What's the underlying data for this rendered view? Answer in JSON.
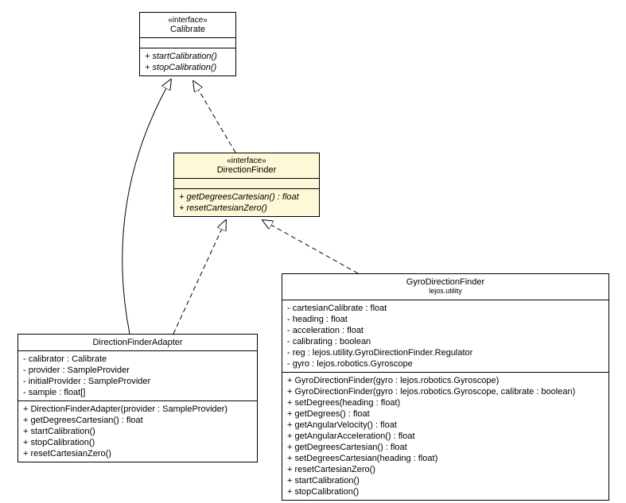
{
  "calibrate": {
    "stereo": "«interface»",
    "name": "Calibrate",
    "ops": [
      "+ startCalibration()",
      "+ stopCalibration()"
    ]
  },
  "dirfinder": {
    "stereo": "«interface»",
    "name": "DirectionFinder",
    "ops": [
      "+ getDegreesCartesian() : float",
      "+ resetCartesianZero()"
    ]
  },
  "adapter": {
    "name": "DirectionFinderAdapter",
    "attrs": [
      "- calibrator : Calibrate",
      "- provider : SampleProvider",
      "- initialProvider : SampleProvider",
      "- sample : float[]"
    ],
    "ops": [
      "+ DirectionFinderAdapter(provider : SampleProvider)",
      "+ getDegreesCartesian() : float",
      "+ startCalibration()",
      "+ stopCalibration()",
      "+ resetCartesianZero()"
    ]
  },
  "gyro": {
    "name": "GyroDirectionFinder",
    "pkg": "lejos.utility",
    "attrs": [
      "- cartesianCalibrate : float",
      "- heading : float",
      "- acceleration : float",
      "- calibrating : boolean",
      "- reg : lejos.utility.GyroDirectionFinder.Regulator",
      "- gyro : lejos.robotics.Gyroscope"
    ],
    "ops": [
      "+ GyroDirectionFinder(gyro : lejos.robotics.Gyroscope)",
      "+ GyroDirectionFinder(gyro : lejos.robotics.Gyroscope, calibrate : boolean)",
      "+ setDegrees(heading : float)",
      "+ getDegrees() : float",
      "+ getAngularVelocity() : float",
      "+ getAngularAcceleration() : float",
      "+ getDegreesCartesian() : float",
      "+ setDegreesCartesian(heading : float)",
      "+ resetCartesianZero()",
      "+ startCalibration()",
      "+ stopCalibration()"
    ]
  }
}
